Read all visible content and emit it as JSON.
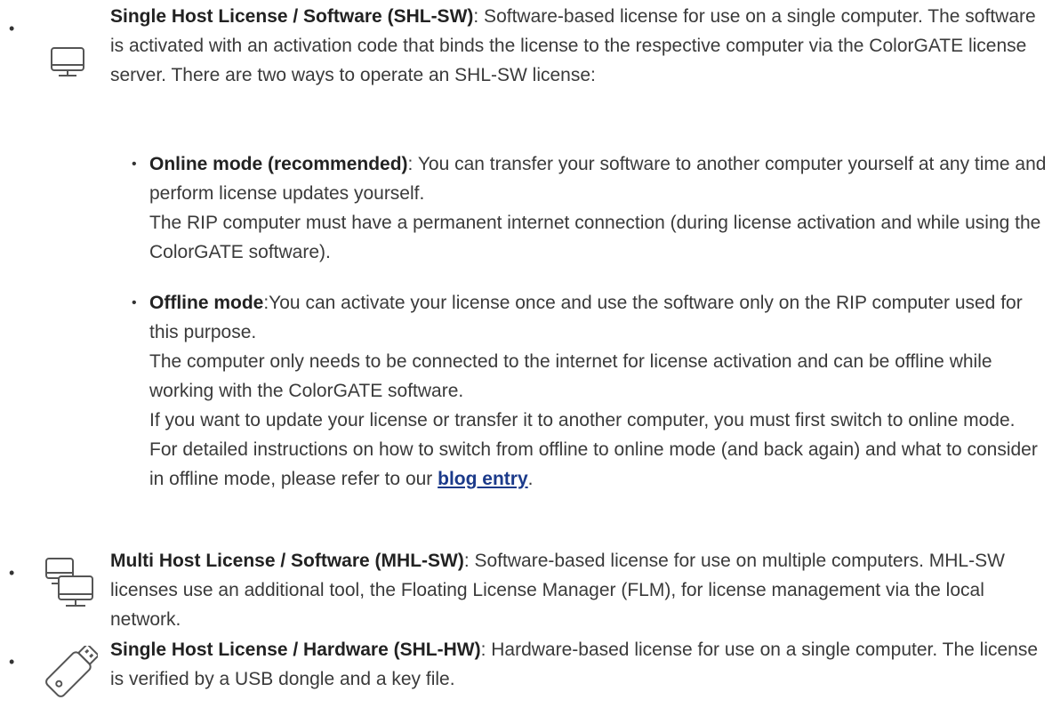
{
  "items": [
    {
      "term": "Single Host License / Software (SHL-SW)",
      "desc": ": Software-based license for use on a single computer. The software is activated with an activation code that binds the license to the respective computer via the ColorGATE license server. There are two ways to operate an SHL-SW license:",
      "icon": "monitor-icon",
      "modes": [
        {
          "term": "Online mode (recommended)",
          "desc1": ": You can transfer your software to another computer yourself at any time and perform license updates yourself.",
          "desc2": "The RIP computer must have a permanent internet connection (during license activation and while using the ColorGATE software)."
        },
        {
          "term": "Offline mode",
          "desc1": ":You can activate your license once and use the software only on the RIP computer used for this purpose.",
          "desc2": "The computer only needs to be connected to the internet for license activation and can be offline while working with the ColorGATE software.",
          "desc3": "If you want to update your license or transfer it to another computer, you must first switch to online mode. For detailed instructions on how to switch from offline to online mode (and back again) and what to consider in offline mode, please refer to our ",
          "link": "blog entry",
          "after_link": "."
        }
      ]
    },
    {
      "term": "Multi Host License / Software (MHL-SW)",
      "desc": ": Software-based license for use on multiple computers. MHL-SW licenses use an additional tool, the Floating License Manager (FLM), for license management via the local network.",
      "icon": "multi-monitor-icon"
    },
    {
      "term": "Single Host License / Hardware (SHL-HW)",
      "desc": ": Hardware-based license for use on a single computer. The license is verified by a USB dongle and a key file.",
      "icon": "usb-dongle-icon"
    }
  ],
  "bullet": "•",
  "colors": {
    "link": "#1b3a8a",
    "text": "#3a3a3a"
  }
}
